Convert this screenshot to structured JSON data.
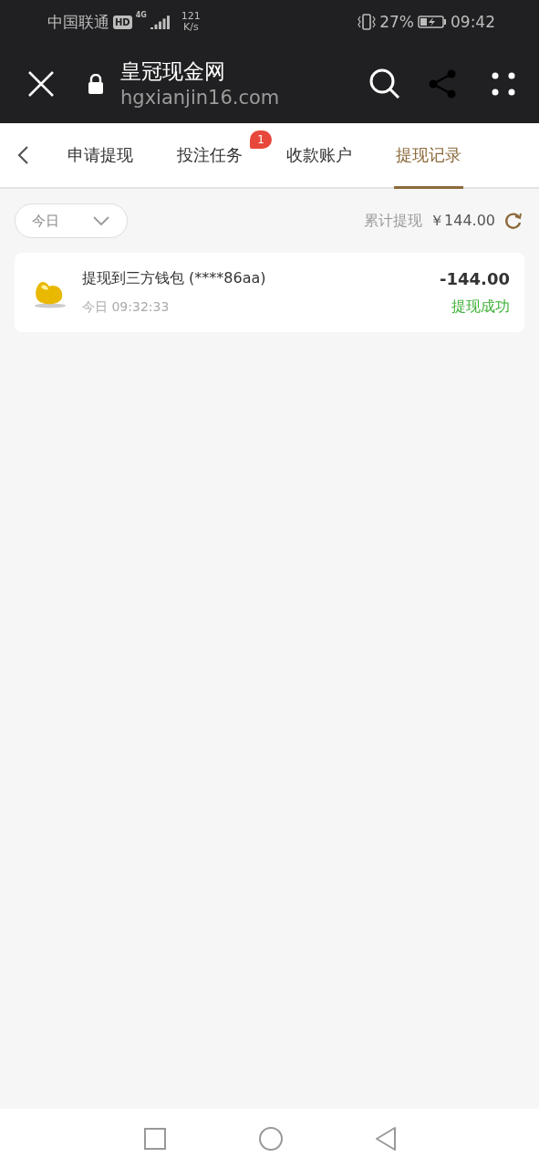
{
  "status_bar": {
    "carrier": "中国联通",
    "network_badge": "HD",
    "network_type": "4G",
    "speed_value": "121",
    "speed_unit": "K/s",
    "battery_percent": "27%",
    "time": "09:42"
  },
  "browser": {
    "title": "皇冠现金网",
    "url": "hgxianjin16.com"
  },
  "tabs": [
    {
      "label": "申请提现",
      "selected": false
    },
    {
      "label": "投注任务",
      "selected": false,
      "badge": "1"
    },
    {
      "label": "收款账户",
      "selected": false
    },
    {
      "label": "提现记录",
      "selected": true
    }
  ],
  "filter": {
    "value": "今日"
  },
  "summary": {
    "label": "累计提现",
    "amount": "￥144.00"
  },
  "records": [
    {
      "title": "提现到三方钱包 (****86aa)",
      "time": "今日 09:32:33",
      "amount": "-144.00",
      "status": "提现成功"
    }
  ]
}
